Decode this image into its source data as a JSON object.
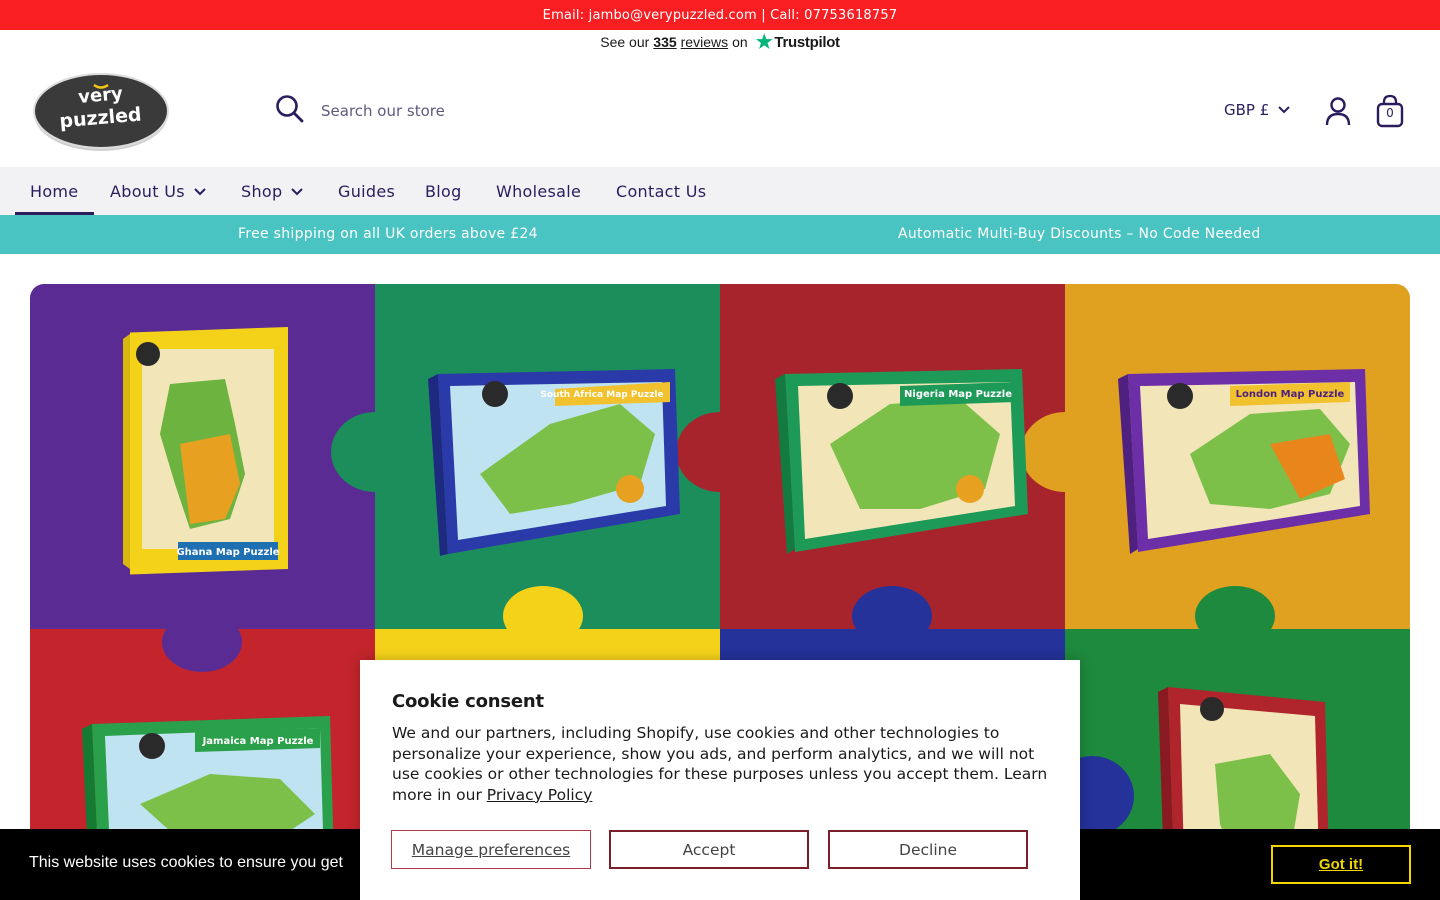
{
  "announcement": {
    "text": "Email: jambo@verypuzzled.com | Call: 07753618757"
  },
  "trustpilot": {
    "prefix": "See our",
    "count": "335",
    "reviews": "reviews",
    "on": "on",
    "brand": "Trustpilot"
  },
  "header": {
    "logo_alt": "Very Puzzled",
    "search_placeholder": "Search our store",
    "currency": "GBP £",
    "cart_count": "0"
  },
  "nav": {
    "items": [
      {
        "label": "Home",
        "active": true
      },
      {
        "label": "About Us",
        "dropdown": true
      },
      {
        "label": "Shop",
        "dropdown": true
      },
      {
        "label": "Guides"
      },
      {
        "label": "Blog"
      },
      {
        "label": "Wholesale"
      },
      {
        "label": "Contact Us"
      }
    ]
  },
  "promo": {
    "left": "Free shipping on all UK orders above £24",
    "right": "Automatic Multi-Buy Discounts – No Code Needed"
  },
  "hero": {
    "puzzles": [
      {
        "title": "Ghana Map Puzzle",
        "bg": "#5a2c93",
        "box": "#f5d21a"
      },
      {
        "title": "South Africa Map Puzzle",
        "bg": "#1b8e5c",
        "box": "#2a3aa8"
      },
      {
        "title": "Nigeria Map Puzzle",
        "bg": "#a8242c",
        "box": "#1d9a57"
      },
      {
        "title": "London Map Puzzle",
        "bg": "#e0a020",
        "box": "#6d2fa8"
      },
      {
        "title": "Jamaica Map Puzzle",
        "bg": "#c4252c",
        "box": "#2aa04a"
      },
      {
        "title": "",
        "bg": "#f5d21a",
        "box": ""
      },
      {
        "title": "",
        "bg": "#24329a",
        "box": ""
      },
      {
        "title": "",
        "bg": "#1e8a3e",
        "box": "#b0242c"
      }
    ]
  },
  "cookie_bar": {
    "text": "This website uses cookies to ensure you get",
    "button": "Got it!"
  },
  "consent": {
    "title": "Cookie consent",
    "body": "We and our partners, including Shopify, use cookies and other technologies to personalize your experience, show you ads, and perform analytics, and we will not use cookies or other technologies for these purposes unless you accept them. Learn more in our",
    "link": "Privacy Policy",
    "manage": "Manage preferences",
    "accept": "Accept",
    "decline": "Decline"
  },
  "colors": {
    "brand": "#2b1c5e",
    "announcement": "#f91e22",
    "promo": "#4ac4c2",
    "trustpilot_star": "#00b67a",
    "got_it": "#f1d600"
  }
}
